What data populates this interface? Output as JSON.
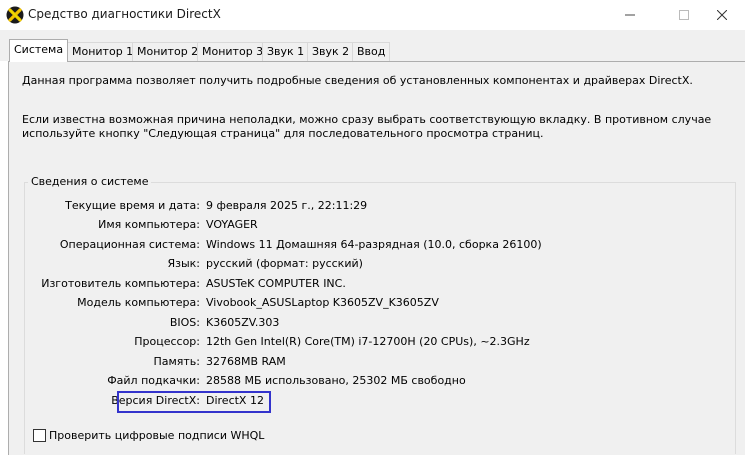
{
  "window": {
    "title": "Средство диагностики DirectX"
  },
  "tabs": [
    {
      "label": "Система"
    },
    {
      "label": "Монитор 1"
    },
    {
      "label": "Монитор 2"
    },
    {
      "label": "Монитор 3"
    },
    {
      "label": "Звук 1"
    },
    {
      "label": "Звук 2"
    },
    {
      "label": "Ввод"
    }
  ],
  "intro_text": "Данная программа позволяет получить подробные сведения об установленных компонентах и драйверах DirectX.",
  "note_text": "Если известна возможная причина неполадки, можно сразу выбрать соответствующую вкладку. В противном случае используйте кнопку \"Следующая страница\" для последовательного просмотра страниц.",
  "system_info": {
    "group_title": "Сведения о системе",
    "rows": [
      {
        "label": "Текущие время и дата:",
        "value": "9 февраля 2025 г., 22:11:29"
      },
      {
        "label": "Имя компьютера:",
        "value": "VOYAGER"
      },
      {
        "label": "Операционная система:",
        "value": "Windows 11 Домашняя 64-разрядная (10.0, сборка 26100)"
      },
      {
        "label": "Язык:",
        "value": "русский (формат: русский)"
      },
      {
        "label": "Изготовитель компьютера:",
        "value": "ASUSTeK COMPUTER INC."
      },
      {
        "label": "Модель компьютера:",
        "value": "Vivobook_ASUSLaptop K3605ZV_K3605ZV"
      },
      {
        "label": "BIOS:",
        "value": "K3605ZV.303"
      },
      {
        "label": "Процессор:",
        "value": "12th Gen Intel(R) Core(TM) i7-12700H (20 CPUs), ~2.3GHz"
      },
      {
        "label": "Память:",
        "value": "32768MB RAM"
      },
      {
        "label": "Файл подкачки:",
        "value": "28588 МБ использовано, 25302 МБ свободно"
      },
      {
        "label": "Версия DirectX:",
        "value": "DirectX 12"
      }
    ]
  },
  "whql_checkbox": {
    "label": "Проверить цифровые подписи WHQL",
    "checked": false
  },
  "colors": {
    "highlight_border": "#3333cc",
    "panel_bg": "#f0f0f0"
  }
}
